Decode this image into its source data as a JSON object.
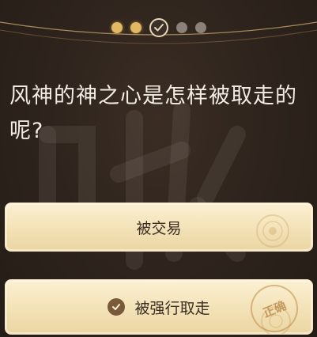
{
  "progress": {
    "steps": [
      "done",
      "done",
      "current",
      "todo",
      "todo"
    ]
  },
  "question": {
    "text": "风神的神之心是怎样被取走的呢?"
  },
  "options": [
    {
      "label": "被交易",
      "selected": false
    },
    {
      "label": "被强行取走",
      "selected": true,
      "stamp": "正确"
    }
  ],
  "colors": {
    "background": "#2d231c",
    "accent_gold": "#e2b860",
    "option_bg": "#f3e2b7"
  }
}
